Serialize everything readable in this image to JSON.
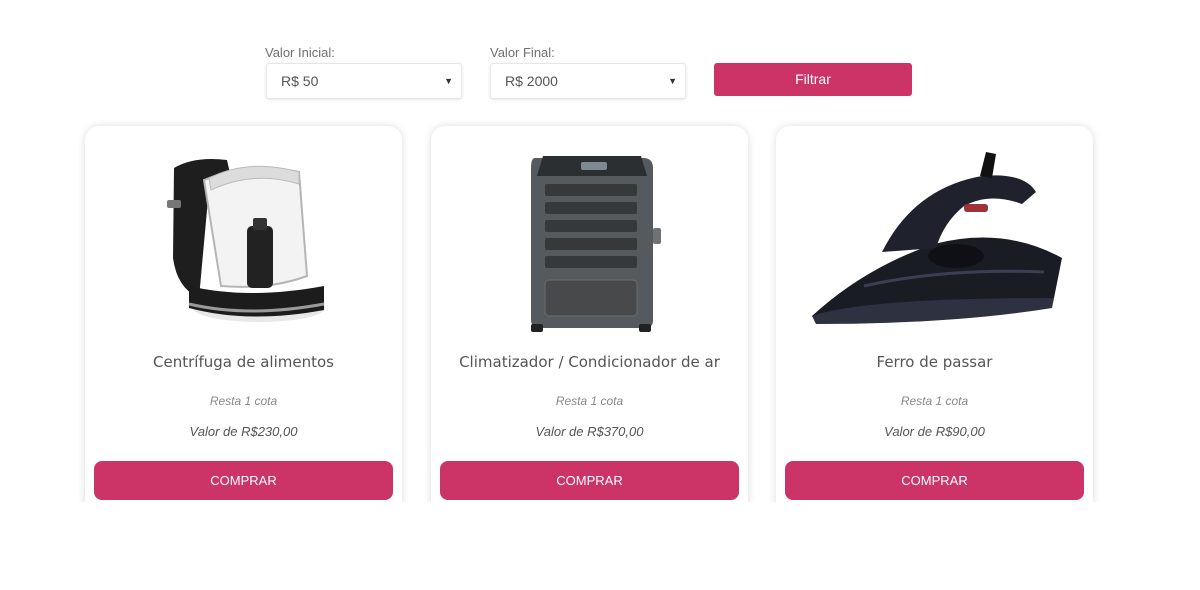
{
  "filter": {
    "initial_label": "Valor Inicial:",
    "initial_value": "R$ 50",
    "final_label": "Valor Final:",
    "final_value": "R$ 2000",
    "button_label": "Filtrar",
    "caret": "▼"
  },
  "accent_color": "#cc3366",
  "products": [
    {
      "name": "Centrífuga de alimentos",
      "stock": "Resta 1 cota",
      "price": "Valor de R$230,00",
      "buy_label": "COMPRAR",
      "image": "food-processor-image"
    },
    {
      "name": "Climatizador / Condicionador de ar",
      "stock": "Resta 1 cota",
      "price": "Valor de R$370,00",
      "buy_label": "COMPRAR",
      "image": "air-cooler-image"
    },
    {
      "name": "Ferro de passar",
      "stock": "Resta 1 cota",
      "price": "Valor de R$90,00",
      "buy_label": "COMPRAR",
      "image": "iron-image"
    }
  ]
}
